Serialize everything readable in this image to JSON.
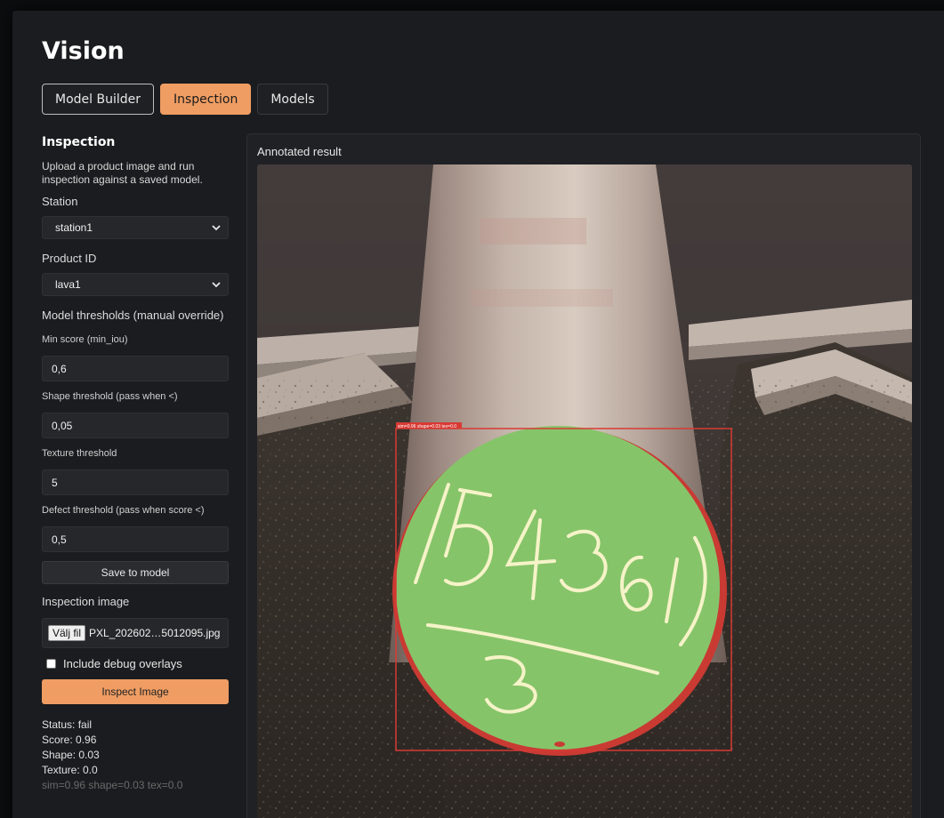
{
  "app": {
    "title": "Vision"
  },
  "tabs": [
    {
      "label": "Model Builder",
      "state": "outlined"
    },
    {
      "label": "Inspection",
      "state": "active"
    },
    {
      "label": "Models",
      "state": "normal"
    }
  ],
  "sidebar": {
    "section_title": "Inspection",
    "description": "Upload a product image and run inspection against a saved model.",
    "station_label": "Station",
    "station_value": "station1",
    "product_label": "Product ID",
    "product_value": "lava1",
    "thresholds_label": "Model thresholds (manual override)",
    "min_score_label": "Min score (min_iou)",
    "min_score_value": "0,6",
    "shape_label": "Shape threshold (pass when <)",
    "shape_value": "0,05",
    "texture_label": "Texture threshold",
    "texture_value": "5",
    "defect_label": "Defect threshold (pass when score <)",
    "defect_value": "0,5",
    "save_label": "Save to model",
    "image_label": "Inspection image",
    "file_button": "Välj fil",
    "file_name": "PXL_202602…5012095.jpg",
    "debug_label": "Include debug overlays",
    "inspect_label": "Inspect Image"
  },
  "result": {
    "status": "Status: fail",
    "score": "Score: 0.96",
    "shape": "Shape: 0.03",
    "texture": "Texture: 0.0",
    "summary": "sim=0.96 shape=0.03 tex=0.0"
  },
  "panel": {
    "title": "Annotated result",
    "overlay_label": "sim=0.96 shape=0.03 tex=0.0",
    "marking_top": "154361",
    "marking_bottom": "3"
  },
  "colors": {
    "accent": "#ef9d63",
    "mask_green": "#86c46a",
    "detection_red": "#d83a34",
    "chalk": "#f6f3c8"
  },
  "icons": {
    "select_chevron": "chevron-down-icon"
  }
}
